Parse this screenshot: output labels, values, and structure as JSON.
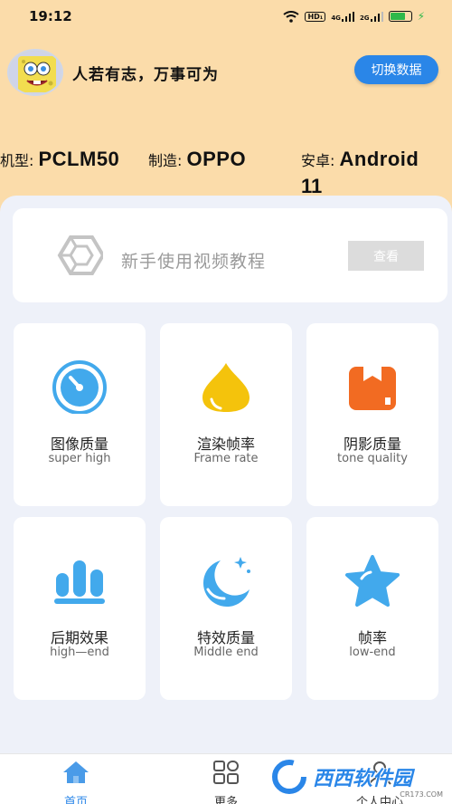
{
  "status_bar": {
    "time": "19:12",
    "icons": [
      "wifi-icon",
      "hd-icon",
      "4g-signal-icon",
      "2g-signal-icon",
      "battery-icon",
      "charging-icon"
    ],
    "hd_label": "HD₁",
    "net1_label": "4G",
    "net2_label": "2G",
    "battery_level": 0.75
  },
  "header": {
    "slogan": "人若有志，万事可为",
    "switch_button_label": "切换数据",
    "model_label": "机型:",
    "model_value": "PCLM50",
    "maker_label": "制造:",
    "maker_value": "OPPO",
    "android_label": "安卓:",
    "android_value_1": "Android",
    "android_value_2": "11"
  },
  "tutorial": {
    "text": "新手使用视频教程",
    "button_label": "查看"
  },
  "tiles": [
    {
      "title": "图像质量",
      "subtitle": "super high",
      "icon": "speedometer-icon",
      "color": "#42a9ec"
    },
    {
      "title": "渲染帧率",
      "subtitle": "Frame rate",
      "icon": "water-drop-icon",
      "color": "#f4c30c"
    },
    {
      "title": "阴影质量",
      "subtitle": "tone quality",
      "icon": "box-icon",
      "color": "#f26b22"
    },
    {
      "title": "后期效果",
      "subtitle": "high—end",
      "icon": "bar-chart-icon",
      "color": "#42a9ec"
    },
    {
      "title": "特效质量",
      "subtitle": "Middle end",
      "icon": "moon-icon",
      "color": "#42a9ec"
    },
    {
      "title": "帧率",
      "subtitle": "low-end",
      "icon": "star-icon",
      "color": "#42a9ec"
    }
  ],
  "bottom_nav": [
    {
      "label": "首页",
      "icon": "home-icon",
      "active": true,
      "color": "#2a86e8"
    },
    {
      "label": "更多",
      "icon": "grid-icon",
      "active": false,
      "color": "#333333"
    },
    {
      "label": "个人中心",
      "icon": "user-icon",
      "active": false,
      "color": "#333333"
    }
  ],
  "watermark": {
    "text": "西西软件园",
    "sub": "CR173.COM"
  }
}
